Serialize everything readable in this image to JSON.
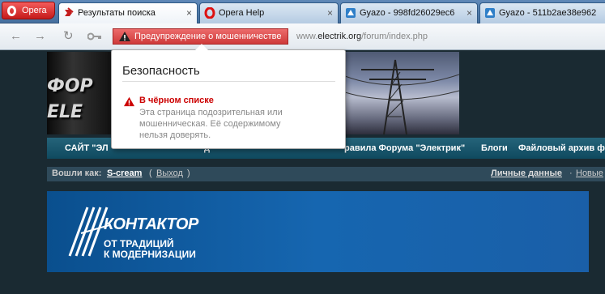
{
  "browser": {
    "menu_label": "Opera",
    "tabs": [
      {
        "title": "Результаты поиска",
        "favicon": "search-results-icon",
        "active": true
      },
      {
        "title": "Opera Help",
        "favicon": "opera-icon",
        "active": false
      },
      {
        "title": "Gyazo - 998fd26029ec6",
        "favicon": "gyazo-icon",
        "active": false
      },
      {
        "title": "Gyazo - 511b2ae38e962",
        "favicon": "gyazo-icon",
        "active": false
      }
    ],
    "close_glyph": "×",
    "fraud_warning_label": "Предупреждение о мошенничестве",
    "address": {
      "prefix": "www.",
      "domain": "electrik.org",
      "path": "/forum/index.php"
    },
    "colors": {
      "fraud_red": "#cf3a3a",
      "tab_active": "#ffffff",
      "tabbar": "#5f88b7"
    }
  },
  "popup": {
    "title": "Безопасность",
    "heading": "В чёрном списке",
    "body": "Эта страница подозрительная или мошенническая. Её содержимому нельзя доверять."
  },
  "site": {
    "logo_lines": [
      "ФОР",
      "ELE"
    ],
    "nav": {
      "items": [
        "САЙТ \"ЭЛ",
        "д",
        "равила Форума \"Электрик\"",
        "Блоги",
        "Файловый архив ф"
      ]
    },
    "userbar": {
      "logged_in_label": "Вошли как:",
      "username": "S-cream",
      "open_paren": "(",
      "logout": "Выход",
      "close_paren": ")",
      "personal_data": "Личные данные",
      "separator": "·",
      "new": "Новые"
    },
    "banner": {
      "brand": "КОНТАКТОР",
      "tagline_1": "ОТ ТРАДИЦИЙ",
      "tagline_2": "К МОДЕРНИЗАЦИИ"
    }
  }
}
